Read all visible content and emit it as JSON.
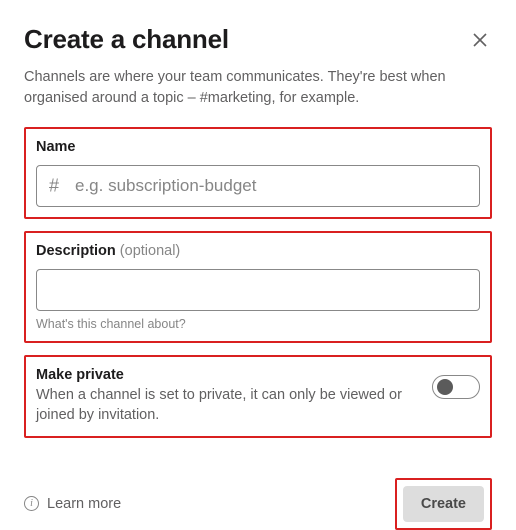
{
  "header": {
    "title": "Create a channel"
  },
  "subtitle": "Channels are where your team communicates. They're best when organised around a topic – #marketing, for example.",
  "name_field": {
    "label": "Name",
    "placeholder": "e.g. subscription-budget",
    "value": ""
  },
  "description_field": {
    "label": "Description",
    "optional": "(optional)",
    "value": "",
    "hint": "What's this channel about?"
  },
  "private_section": {
    "title": "Make private",
    "description": "When a channel is set to private, it can only be viewed or joined by invitation.",
    "enabled": false
  },
  "footer": {
    "learn_more": "Learn more",
    "create_button": "Create"
  }
}
